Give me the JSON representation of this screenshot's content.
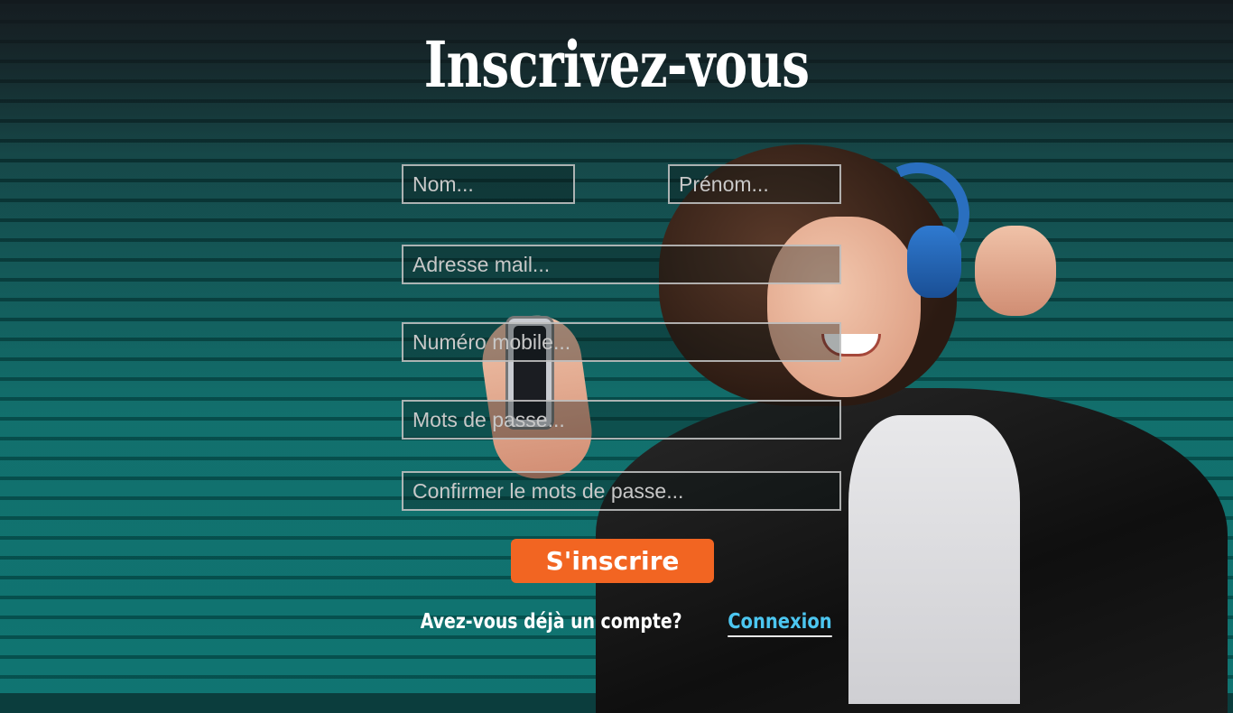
{
  "page": {
    "title": "Inscrivez-vous",
    "accent_color": "#f26522",
    "link_color": "#4cc6f0"
  },
  "form": {
    "nom_placeholder": "Nom...",
    "prenom_placeholder": "Prénom...",
    "email_placeholder": "Adresse mail...",
    "mobile_placeholder": "Numéro mobile...",
    "password_placeholder": "Mots de passe...",
    "confirm_password_placeholder": "Confirmer le mots de passe...",
    "submit_label": "S'inscrire"
  },
  "footer": {
    "question": "Avez-vous déjà un compte?",
    "login_link": "Connexion"
  }
}
